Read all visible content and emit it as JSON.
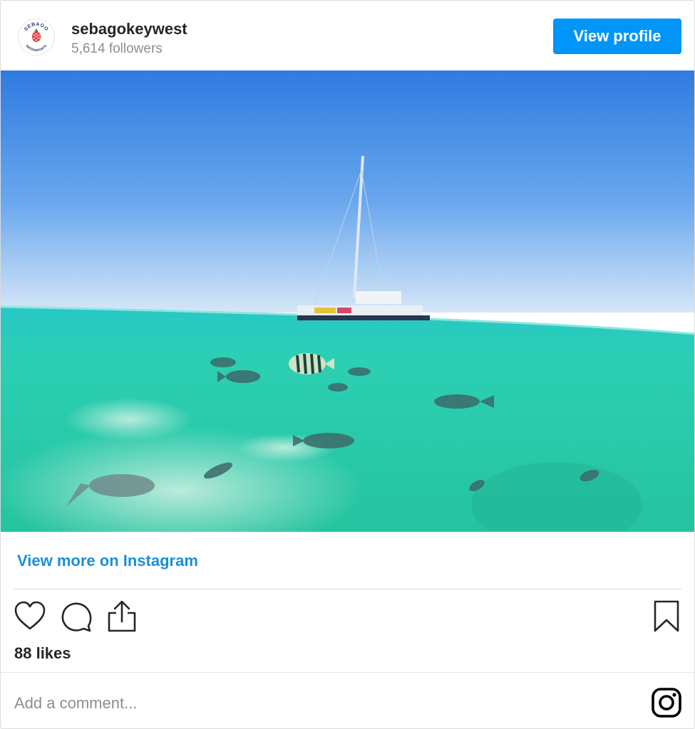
{
  "profile": {
    "username": "sebagokeywest",
    "followers": "5,614 followers",
    "view_profile_label": "View profile",
    "avatar": {
      "top_text": "SEBAGO",
      "bottom_text": "WATERSPORTS",
      "icon": "pineapple-icon",
      "accent_color": "#d6262f",
      "text_color": "#2a3f7a"
    }
  },
  "post": {
    "image_alt": "",
    "view_more_label": "View more on Instagram",
    "likes": "88 likes",
    "actions": [
      "heart-icon",
      "comment-icon",
      "share-icon",
      "bookmark-icon"
    ],
    "comment_placeholder": "Add a comment...",
    "footer_icon": "instagram-logo-icon"
  },
  "colors": {
    "link_blue": "#1a8fd8",
    "button_blue": "#0095f6",
    "sky_top": "#2f7be0",
    "water": "#2ccfb3"
  }
}
